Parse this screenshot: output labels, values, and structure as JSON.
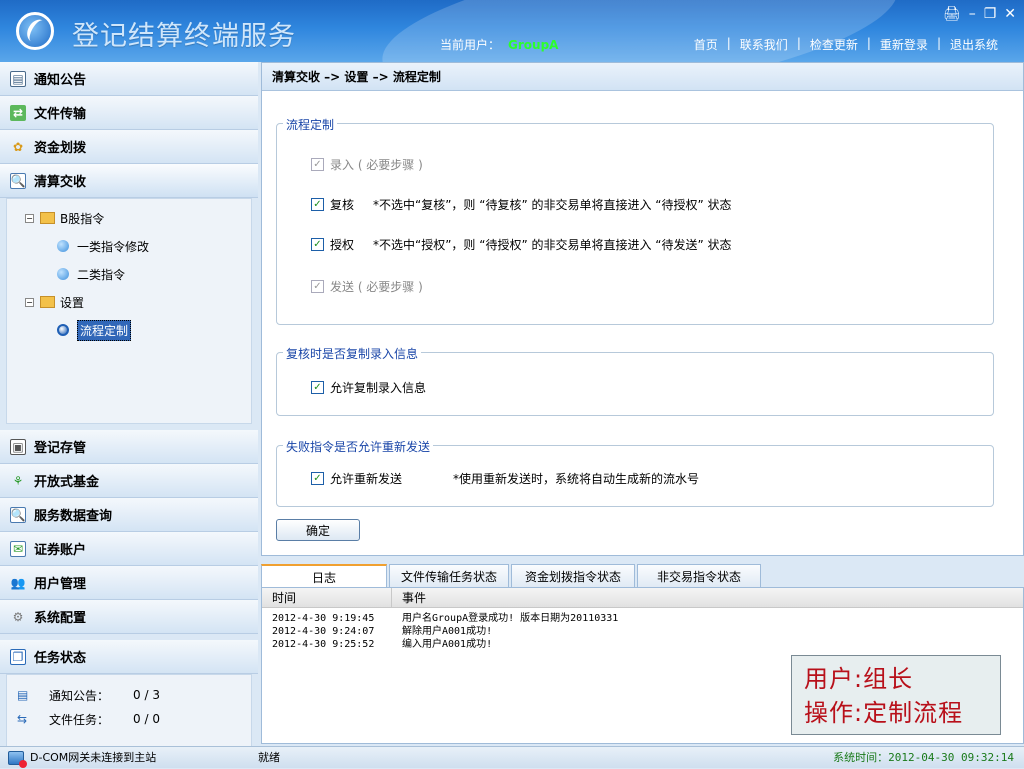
{
  "header": {
    "app_title": "登记结算终端服务",
    "current_user_label": "当前用户：",
    "current_user": "GroupA",
    "nav": [
      "首页",
      "联系我们",
      "检查更新",
      "重新登录",
      "退出系统"
    ],
    "nav_sep": "|",
    "window_controls": [
      "lock-icon",
      "minimize-icon",
      "restore-icon",
      "close-icon"
    ]
  },
  "sidebar": {
    "items_top": [
      {
        "label": "通知公告",
        "icon": "notice-icon"
      },
      {
        "label": "文件传输",
        "icon": "file-transfer-icon"
      },
      {
        "label": "资金划拨",
        "icon": "fund-transfer-icon"
      },
      {
        "label": "清算交收",
        "icon": "settlement-icon"
      }
    ],
    "tree": {
      "group1": "B股指令",
      "group1_children": [
        "一类指令修改",
        "二类指令"
      ],
      "group2": "设置",
      "group2_children": [
        "流程定制"
      ]
    },
    "items_bottom": [
      {
        "label": "登记存管",
        "icon": "registry-icon"
      },
      {
        "label": "开放式基金",
        "icon": "fund-icon"
      },
      {
        "label": "服务数据查询",
        "icon": "query-icon"
      },
      {
        "label": "证券账户",
        "icon": "account-icon"
      },
      {
        "label": "用户管理",
        "icon": "users-icon"
      },
      {
        "label": "系统配置",
        "icon": "gear-icon"
      }
    ],
    "task_status": {
      "title": "任务状态",
      "rows": [
        {
          "label": "通知公告：",
          "value": "0 / 3"
        },
        {
          "label": "文件任务：",
          "value": "0 / 0"
        }
      ]
    }
  },
  "main": {
    "breadcrumb": "清算交收 –> 设置 –> 流程定制",
    "group1": {
      "legend": "流程定制",
      "rows": [
        {
          "label": "录入 ( 必要步骤 )",
          "checked": true,
          "disabled": true,
          "note": ""
        },
        {
          "label": "复核",
          "checked": true,
          "disabled": false,
          "note": "*不选中“复核”，则 “待复核” 的非交易单将直接进入 “待授权” 状态"
        },
        {
          "label": "授权",
          "checked": true,
          "disabled": false,
          "note": "*不选中“授权”，则 “待授权” 的非交易单将直接进入 “待发送” 状态"
        },
        {
          "label": "发送 ( 必要步骤 )",
          "checked": true,
          "disabled": true,
          "note": ""
        }
      ]
    },
    "group2": {
      "legend": "复核时是否复制录入信息",
      "label": "允许复制录入信息"
    },
    "group3": {
      "legend": "失败指令是否允许重新发送",
      "label": "允许重新发送",
      "note": "*使用重新发送时，系统将自动生成新的流水号"
    },
    "confirm_button": "确定"
  },
  "bottom_tabs": [
    "日志",
    "文件传输任务状态",
    "资金划拨指令状态",
    "非交易指令状态"
  ],
  "log": {
    "col_time": "时间",
    "col_event": "事件",
    "rows": [
      {
        "time": "2012-4-30 9:19:45",
        "event": "用户名GroupA登录成功! 版本日期为20110331"
      },
      {
        "time": "2012-4-30 9:24:07",
        "event": "解除用户A001成功!"
      },
      {
        "time": "2012-4-30 9:25:52",
        "event": "编入用户A001成功!"
      }
    ]
  },
  "overlay": {
    "line1": "用户:组长",
    "line2": "操作:定制流程"
  },
  "statusbar": {
    "gateway": "D-COM网关未连接到主站",
    "state": "就绪",
    "time_label": "系统时间：",
    "time_value": "2012-04-30 09:32:14"
  }
}
